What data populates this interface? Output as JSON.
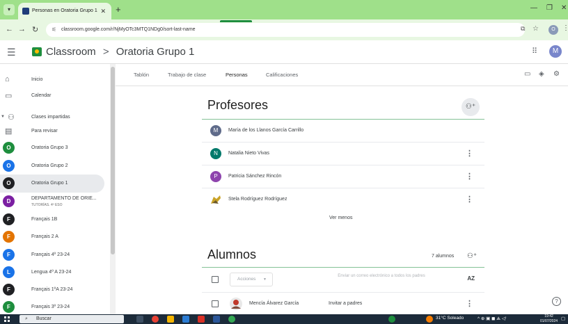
{
  "browser": {
    "tab_title": "Personas en Oratoria Grupo 1",
    "url": "classroom.google.com/r/NjMyOTc3MTQ1NDg0/sort-last-name",
    "profile_initial": "O"
  },
  "header": {
    "app_name": "Classroom",
    "separator": ">",
    "class_name": "Oratoria Grupo 1",
    "user_initial": "M"
  },
  "sidebar": {
    "inicio": "Inicio",
    "calendar": "Calendar",
    "clases_impartidas": "Clases impartidas",
    "para_revisar": "Para revisar",
    "classes": [
      {
        "initial": "O",
        "label": "Oratoria Grupo 3",
        "sub": "",
        "color": "#1e8e3e"
      },
      {
        "initial": "O",
        "label": "Oratoria Grupo 2",
        "sub": "",
        "color": "#1a73e8"
      },
      {
        "initial": "O",
        "label": "Oratoria Grupo 1",
        "sub": "",
        "color": "#202124"
      },
      {
        "initial": "D",
        "label": "DEPARTAMENTO DE ORIE...",
        "sub": "TUTORÍAS. 4º ESO",
        "color": "#7b1fa2"
      },
      {
        "initial": "F",
        "label": "Français 1B",
        "sub": "",
        "color": "#202124"
      },
      {
        "initial": "F",
        "label": "Français 2 A",
        "sub": "",
        "color": "#e37400"
      },
      {
        "initial": "F",
        "label": "Français 4º 23-24",
        "sub": "",
        "color": "#1a73e8"
      },
      {
        "initial": "L",
        "label": "Lengua 4º A 23-24",
        "sub": "",
        "color": "#1a73e8"
      },
      {
        "initial": "F",
        "label": "Français 1ºA 23-24",
        "sub": "",
        "color": "#202124"
      },
      {
        "initial": "F",
        "label": "Français 3º 23-24",
        "sub": "",
        "color": "#1e8e3e"
      }
    ]
  },
  "tabs": {
    "tablon": "Tablón",
    "trabajo": "Trabajo de clase",
    "personas": "Personas",
    "calificaciones": "Calificaciones"
  },
  "profesores": {
    "title": "Profesores",
    "list": [
      {
        "initial": "M",
        "name": "María de los Llanos García Carrillo",
        "color": "#5f6b8a"
      },
      {
        "initial": "N",
        "name": "Natalia Nieto Vivas",
        "color": "#00796b"
      },
      {
        "initial": "P",
        "name": "Patricia Sánchez Rincón",
        "color": "#8e44ad"
      },
      {
        "initial": "",
        "name": "Stela Rodríguez Rodríguez",
        "color": "#c9a227"
      }
    ],
    "ver_menos": "Ver menos"
  },
  "alumnos": {
    "title": "Alumnos",
    "count": "7 alumnos",
    "actions": "Acciones",
    "email_parents": "Enviar un correo electrónico a todos los padres",
    "sort_icon": "AZ",
    "first_student": "Mencía Álvarez García",
    "invite": "Invitar a padres"
  },
  "taskbar": {
    "search": "Buscar",
    "weather": "31°C  Soleado",
    "time": "19:42",
    "date": "01/07/2024"
  }
}
